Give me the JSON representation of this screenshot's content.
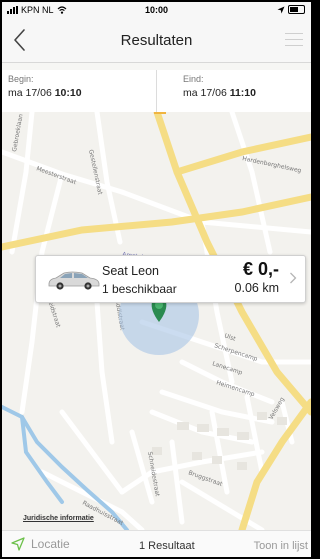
{
  "status_bar": {
    "carrier": "KPN NL",
    "time": "10:00"
  },
  "nav": {
    "title": "Resultaten"
  },
  "dates": {
    "begin_label": "Begin:",
    "begin_day": "ma 17/06",
    "begin_time": "10:10",
    "end_label": "Eind:",
    "end_day": "ma 17/06",
    "end_time": "11:10"
  },
  "map": {
    "streets": [
      "Gebroeklaan",
      "Gestellenstraat",
      "Meesterstraat",
      "Hardenberghelsweg",
      "Amstel van Nijbeek",
      "Nijverheidstraat",
      "Gouddistraat",
      "Ulst",
      "Scherpencamp",
      "Lanecamp",
      "Heimencamp",
      "Velsweg",
      "Schneidestraat",
      "Bruggstraat",
      "Raadhuisstraat"
    ],
    "legal_link": "Juridische informatie"
  },
  "result": {
    "car_name": "Seat Leon",
    "availability": "1 beschikbaar",
    "price": "€ 0,-",
    "distance": "0.06 km"
  },
  "bottom_bar": {
    "location_label": "Locatie",
    "result_count": "1 Resultaat",
    "list_label": "Toon in lijst"
  },
  "colors": {
    "accent_green": "#6cc04a",
    "major_road": "#f7e08a",
    "map_water": "#9fc8e8",
    "location_radius": "#a9c4e6"
  }
}
